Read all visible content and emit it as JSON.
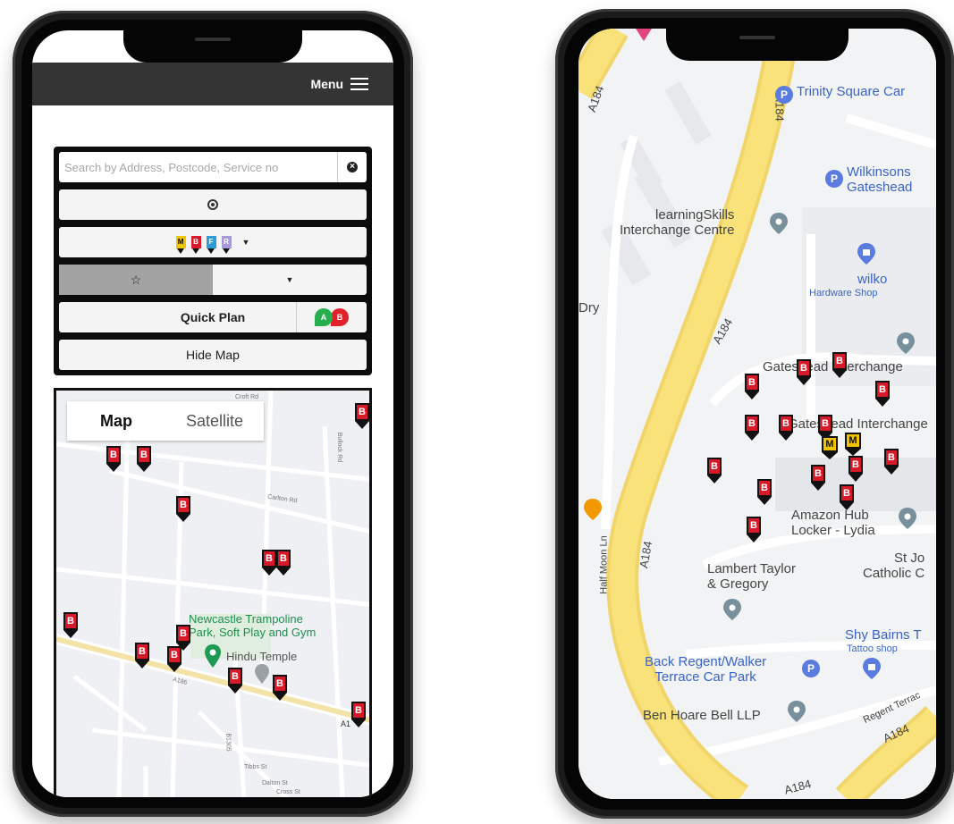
{
  "left_phone": {
    "topbar": {
      "menu_label": "Menu"
    },
    "search": {
      "placeholder": "Search by Address, Postcode, Service no"
    },
    "mode_filters": [
      "M",
      "B",
      "F",
      "R"
    ],
    "mode_colors": {
      "M": "#f2c400",
      "B": "#d8192a",
      "F": "#2d9bd6",
      "R": "#a89ad9"
    },
    "quick_plan": {
      "label": "Quick Plan",
      "from": "A",
      "to": "B"
    },
    "hide_map": {
      "label": "Hide Map"
    },
    "favourites_icon": "star-icon",
    "map": {
      "type_toggle": {
        "map": "Map",
        "satellite": "Satellite"
      },
      "places": {
        "trampoline": "Newcastle Trampoline\nPark, Soft Play and Gym",
        "temple": "Hindu Temple"
      },
      "streets": [
        "Croft Rd",
        "Carlton Rd",
        "Bullock Rd",
        "A186",
        "B1305",
        "Tibbs St",
        "Dalton St",
        "Cross St",
        "A1"
      ],
      "stop_letter": "B"
    }
  },
  "right_phone": {
    "map": {
      "places": {
        "trinity": "Trinity Square Car",
        "wilkinsons": "Wilkinsons\nGateshead",
        "learning": "learningSkills\nInterchange Centre",
        "wilko": "wilko",
        "wilko_sub": "Hardware Shop",
        "interchange_top": "Gateshead Interchange",
        "interchange_mid": "Gateshead Interchange",
        "amazon": "Amazon Hub\nLocker - Lydia",
        "lambert": "Lambert Taylor\n& Gregory",
        "stjos": "St Jo\nCatholic C",
        "shy": "Shy Bairns T",
        "shy_sub": "Tattoo shop",
        "backregent": "Back Regent/Walker\nTerrace Car Park",
        "benhoare": "Ben Hoare Bell LLP",
        "regent": "Regent Terrac",
        "halfmoon": "Half Moon Ln",
        "dry": "Dry"
      },
      "roads": [
        "A184",
        "A184",
        "A184",
        "A184",
        "A184",
        "A184",
        "A184"
      ],
      "stop_letter": "B",
      "metro_letter": "M"
    }
  }
}
